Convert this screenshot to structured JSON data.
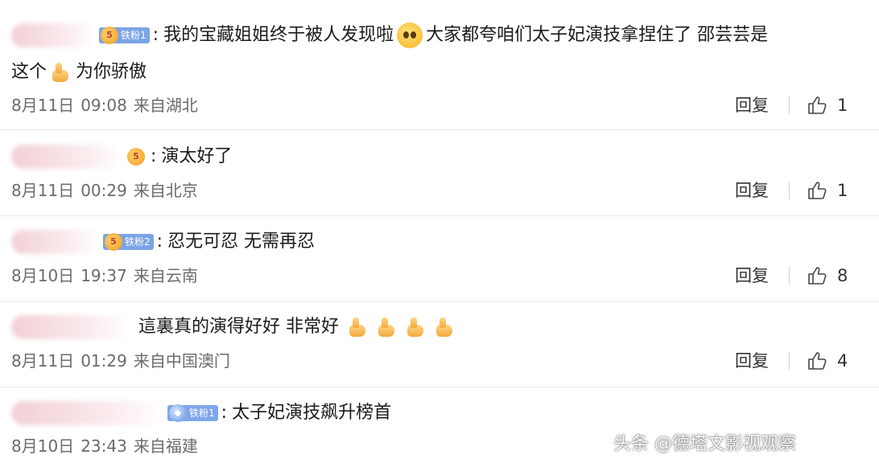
{
  "comments": [
    {
      "badge": "铁粉1",
      "text_a": "我的宝藏姐姐终于被人发现啦",
      "text_b": "大家都夸咱们太子妃演技拿捏住了 邵芸芸是",
      "text_c": "这个",
      "text_d": "为你骄傲",
      "date": "8月11日",
      "time": "09:08",
      "location": "来自湖北",
      "reply": "回复",
      "likes": "1"
    },
    {
      "badge": "",
      "text_a": "演太好了",
      "date": "8月11日",
      "time": "00:29",
      "location": "来自北京",
      "reply": "回复",
      "likes": "1"
    },
    {
      "badge": "铁粉2",
      "text_a": "忍无可忍 无需再忍",
      "date": "8月10日",
      "time": "19:37",
      "location": "来自云南",
      "reply": "回复",
      "likes": "8"
    },
    {
      "badge": "",
      "text_a": "這裏真的演得好好 非常好",
      "date": "8月11日",
      "time": "01:29",
      "location": "来自中国澳门",
      "reply": "回复",
      "likes": "4"
    },
    {
      "badge": "铁粉1",
      "text_a": "太子妃演技飙升榜首",
      "date": "8月10日",
      "time": "23:43",
      "location": "来自福建",
      "reply": "回复",
      "likes": ""
    }
  ],
  "watermark": "头条 @德塔文影视观察",
  "icons": {
    "emoji": "pleading-face-emoji",
    "thumbs": "thumbs-up-emoji",
    "like": "thumb-up-outline-icon"
  }
}
